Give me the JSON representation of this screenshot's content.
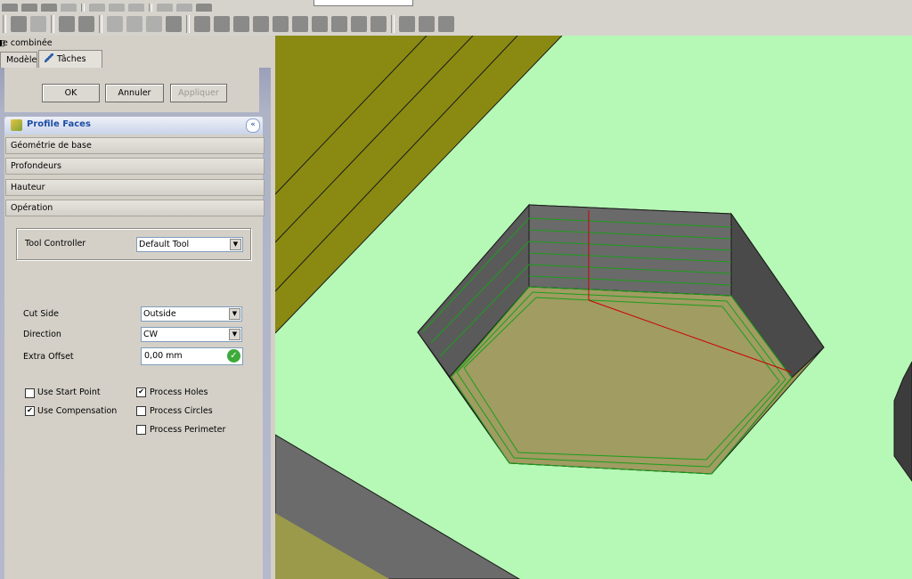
{
  "window": {
    "panel_title": "ue combinée"
  },
  "tabs": [
    {
      "label": "Modèle"
    },
    {
      "label": "Tâches"
    }
  ],
  "buttons": {
    "ok": "OK",
    "cancel": "Annuler",
    "apply": "Appliquer"
  },
  "taskbox": {
    "title": "Profile Faces",
    "sections": [
      "Géométrie de base",
      "Profondeurs",
      "Hauteur",
      "Opération"
    ]
  },
  "operation": {
    "tool_controller_label": "Tool Controller",
    "tool_controller_value": "Default Tool",
    "cut_side_label": "Cut Side",
    "cut_side_value": "Outside",
    "direction_label": "Direction",
    "direction_value": "CW",
    "extra_offset_label": "Extra Offset",
    "extra_offset_value": "0,00 mm",
    "checkboxes": [
      {
        "label": "Use Start Point",
        "checked": false
      },
      {
        "label": "Use Compensation",
        "checked": true
      },
      {
        "label": "Process Holes",
        "checked": true
      },
      {
        "label": "Process Circles",
        "checked": false
      },
      {
        "label": "Process Perimeter",
        "checked": false
      }
    ]
  },
  "colors": {
    "viewport_bg": "#b6f8b6",
    "stock_olive": "#8a8a12",
    "pocket_floor": "#9a9a52",
    "toolpath": "#1a9e1a",
    "axis_red": "#cc0000",
    "header_blue": "#1d4ea6"
  },
  "icons": [
    "freecad-toolbar-icons",
    "profile-faces-icon",
    "edit-pencil-icon",
    "collapse-chevron-icon",
    "valid-check-icon",
    "dock-float-icon"
  ]
}
